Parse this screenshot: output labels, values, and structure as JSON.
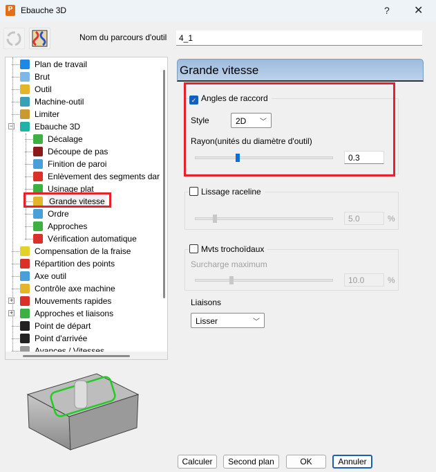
{
  "window": {
    "title": "Ebauche 3D",
    "app_icon_letter": "P",
    "help": "?",
    "close": "✕"
  },
  "toolbar": {
    "name_label": "Nom du parcours d'outil",
    "name_value": "4_1"
  },
  "tree": {
    "items": [
      {
        "label": "Plan de travail",
        "level": 1,
        "icon": "workplane-icon",
        "color": "#1e88e5"
      },
      {
        "label": "Brut",
        "level": 1,
        "icon": "block-icon",
        "color": "#7fb8e6"
      },
      {
        "label": "Outil",
        "level": 1,
        "icon": "tool-icon",
        "color": "#e2b52a"
      },
      {
        "label": "Machine-outil",
        "level": 1,
        "icon": "machine-tool-icon",
        "color": "#3aa0b8"
      },
      {
        "label": "Limiter",
        "level": 1,
        "icon": "limit-icon",
        "color": "#c89a30"
      },
      {
        "label": "Ebauche 3D",
        "level": 1,
        "icon": "layers-icon",
        "color": "#1fb3a8",
        "expander": "−"
      },
      {
        "label": "Décalage",
        "level": 2,
        "icon": "offset-icon",
        "color": "#3cb043"
      },
      {
        "label": "Découpe de pas",
        "level": 2,
        "icon": "stepdown-icon",
        "color": "#8b1a1a"
      },
      {
        "label": "Finition de paroi",
        "level": 2,
        "icon": "wall-finish-icon",
        "color": "#4a9fd8"
      },
      {
        "label": "Enlèvement des segments dar",
        "level": 2,
        "icon": "segment-removal-icon",
        "color": "#d9302a"
      },
      {
        "label": "Usinage plat",
        "level": 2,
        "icon": "flat-machining-icon",
        "color": "#3cb043"
      },
      {
        "label": "Grande vitesse",
        "level": 2,
        "icon": "high-speed-icon",
        "color": "#e2b52a",
        "selected": true
      },
      {
        "label": "Ordre",
        "level": 2,
        "icon": "order-icon",
        "color": "#4a9fd8"
      },
      {
        "label": "Approches",
        "level": 2,
        "icon": "approaches-icon",
        "color": "#3cb043"
      },
      {
        "label": "Vérification automatique",
        "level": 2,
        "icon": "auto-verify-icon",
        "color": "#d9302a"
      },
      {
        "label": "Compensation de la fraise",
        "level": 1,
        "icon": "cutter-comp-icon",
        "color": "#e2d12a"
      },
      {
        "label": "Répartition des points",
        "level": 1,
        "icon": "point-distribution-icon",
        "color": "#d9302a"
      },
      {
        "label": "Axe outil",
        "level": 1,
        "icon": "tool-axis-icon",
        "color": "#4a9fd8"
      },
      {
        "label": "Contrôle axe machine",
        "level": 1,
        "icon": "axis-control-icon",
        "color": "#e2b52a"
      },
      {
        "label": "Mouvements rapides",
        "level": 1,
        "icon": "rapid-moves-icon",
        "color": "#d9302a",
        "expander": "+"
      },
      {
        "label": "Approches et liaisons",
        "level": 1,
        "icon": "leads-links-icon",
        "color": "#3cb043",
        "expander": "+"
      },
      {
        "label": "Point de départ",
        "level": 1,
        "icon": "start-point-icon",
        "color": "#222222"
      },
      {
        "label": "Point d'arrivée",
        "level": 1,
        "icon": "end-point-icon",
        "color": "#222222"
      },
      {
        "label": "Avances / Vitesses",
        "level": 1,
        "icon": "feeds-speeds-icon",
        "color": "#999999"
      }
    ]
  },
  "panel": {
    "title": "Grande vitesse",
    "corner": {
      "label": "Angles de raccord",
      "checked": true,
      "style_label": "Style",
      "style_value": "2D",
      "radius_label": "Rayon(unités du diamètre d'outil)",
      "radius_value": "0.3",
      "slider_fraction": 0.3
    },
    "raceline": {
      "label": "Lissage raceline",
      "checked": false,
      "value": "5.0",
      "unit": "%",
      "slider_fraction": 0.13
    },
    "trochoidal": {
      "label": "Mvts trochoïdaux",
      "checked": false,
      "sub_label": "Surcharge maximum",
      "value": "10.0",
      "unit": "%",
      "slider_fraction": 0.25
    },
    "links": {
      "label": "Liaisons",
      "value": "Lisser"
    }
  },
  "buttons": {
    "calc": "Calculer",
    "background": "Second plan",
    "ok": "OK",
    "cancel": "Annuler"
  },
  "colors": {
    "accent": "#1060c0",
    "highlight": "#e8202a",
    "toolpath": "#22cc22"
  }
}
